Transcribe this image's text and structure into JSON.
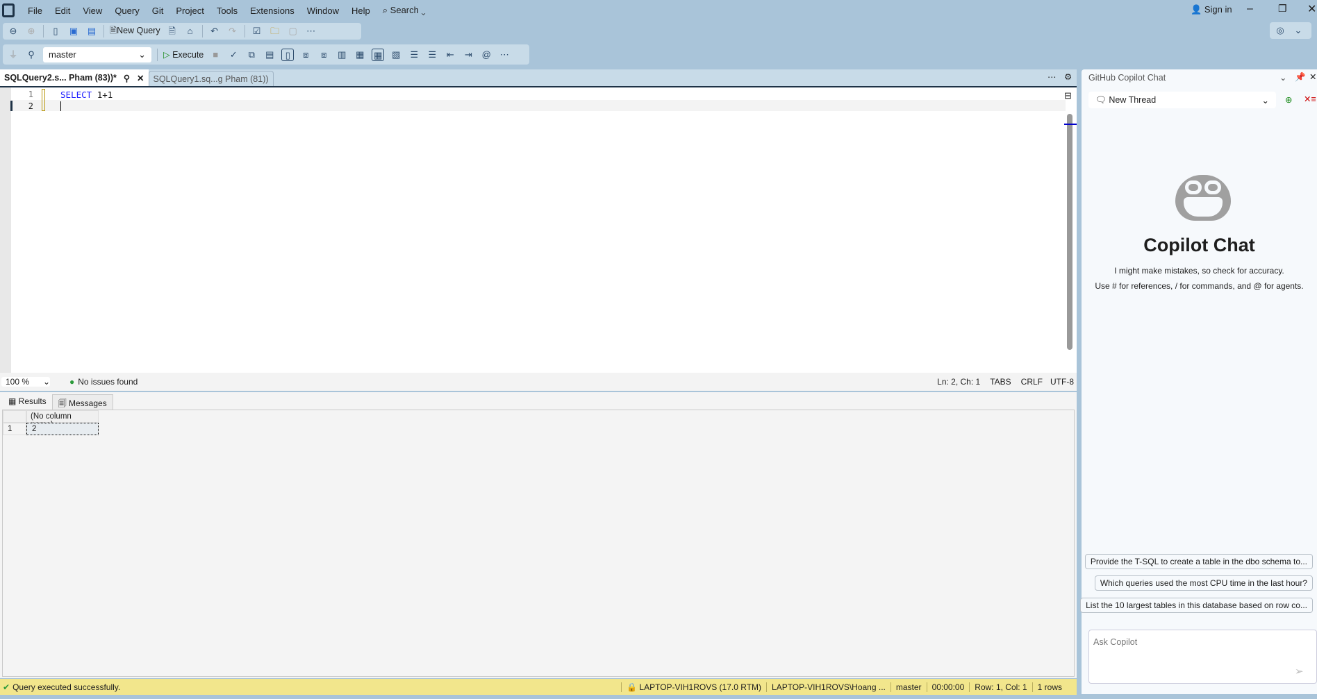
{
  "menubar": {
    "items": [
      "File",
      "Edit",
      "View",
      "Query",
      "Git",
      "Project",
      "Tools",
      "Extensions",
      "Window",
      "Help"
    ],
    "search": "Search",
    "sign_in": "Sign in"
  },
  "toolbar1": {
    "new_query": "New Query"
  },
  "toolbar2": {
    "database": "master",
    "execute": "Execute"
  },
  "tabs": [
    {
      "label": "SQLQuery2.s... Pham (83))*",
      "active": true
    },
    {
      "label": "SQLQuery1.sq...g Pham (81))",
      "active": false
    }
  ],
  "editor": {
    "lines": [
      {
        "num": "1",
        "keyword": "SELECT",
        "rest": "1+1"
      },
      {
        "num": "2"
      }
    ]
  },
  "zoombar": {
    "zoom": "100 %",
    "issues": "No issues found",
    "position": "Ln: 2, Ch: 1",
    "indent": "TABS",
    "eol": "CRLF",
    "encoding": "UTF-8"
  },
  "results": {
    "tabs": [
      "Results",
      "Messages"
    ],
    "columns": [
      "(No column name)"
    ],
    "rows": [
      {
        "num": "1",
        "cells": [
          "2"
        ]
      }
    ]
  },
  "statusbar": {
    "message": "Query executed successfully.",
    "server": "LAPTOP-VIH1ROVS (17.0 RTM)",
    "user": "LAPTOP-VIH1ROVS\\Hoang ...",
    "database": "master",
    "elapsed": "00:00:00",
    "rowcol": "Row: 1, Col: 1",
    "rows": "1 rows",
    "color": "#f2e68c"
  },
  "copilot": {
    "title": "GitHub Copilot Chat",
    "thread": "New Thread",
    "heading": "Copilot Chat",
    "disclaimer": "I might make mistakes, so check for accuracy.",
    "hint": "Use # for references, / for commands, and @ for agents.",
    "suggestions": [
      "Provide the T-SQL to create a table in the dbo schema to...",
      "Which queries used the most CPU time in the last hour?",
      "List the 10 largest tables in this database based on row co..."
    ],
    "placeholder": "Ask Copilot"
  }
}
